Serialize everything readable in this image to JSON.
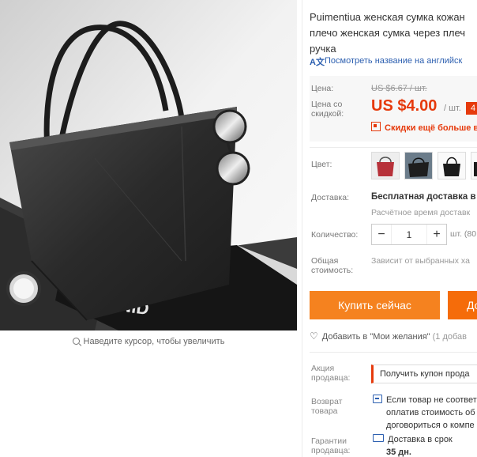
{
  "product": {
    "title_lines": [
      "Puimentiua женская сумка кожан",
      "плечо женская сумка через плеч",
      "ручка"
    ],
    "translate_link": "Посмотреть название на английск",
    "zoom_hint": "Наведите курсор, чтобы увеличить"
  },
  "pricing": {
    "price_label": "Цена:",
    "old_price": "US $6.67 / шт.",
    "discount_label": "Цена со скидкой:",
    "new_price": "US $4.00",
    "per_unit": "/ шт.",
    "badge": "4",
    "coupon_text": "Скидки ещё больше в"
  },
  "options": {
    "color_label": "Цвет:",
    "thumbnails": [
      "red-bag",
      "black-bag-dark",
      "black-bag-white",
      "black-bag-partial"
    ]
  },
  "shipping": {
    "label": "Доставка:",
    "main": "Бесплатная доставка в",
    "sub": "Расчётное время доставк"
  },
  "quantity": {
    "label": "Количество:",
    "value": "1",
    "minus": "−",
    "plus": "+",
    "note": "шт. (80"
  },
  "total": {
    "label_line1": "Общая",
    "label_line2": "стоимость:",
    "note": "Зависит от выбранных ха"
  },
  "actions": {
    "buy_now": "Купить сейчас",
    "add_to_cart": "До"
  },
  "wishlist": {
    "text": "Добавить в \"Мои желания\"",
    "count": "(1 добав"
  },
  "services": {
    "promo_label_1": "Акция",
    "promo_label_2": "продавца:",
    "promo_button": "Получить купон прода",
    "return_label_1": "Возврат",
    "return_label_2": "товара",
    "return_lines": [
      "Если товар не соответ",
      "оплатив стоимость об",
      "договориться о компе"
    ],
    "guarantee_label_1": "Гарантии",
    "guarantee_label_2": "продавца:",
    "guarantee_line": "Доставка в срок",
    "guarantee_days": "35 дн."
  },
  "colors": {
    "accent": "#e63a0c",
    "buy": "#f5821f",
    "link": "#2c5fb0"
  }
}
